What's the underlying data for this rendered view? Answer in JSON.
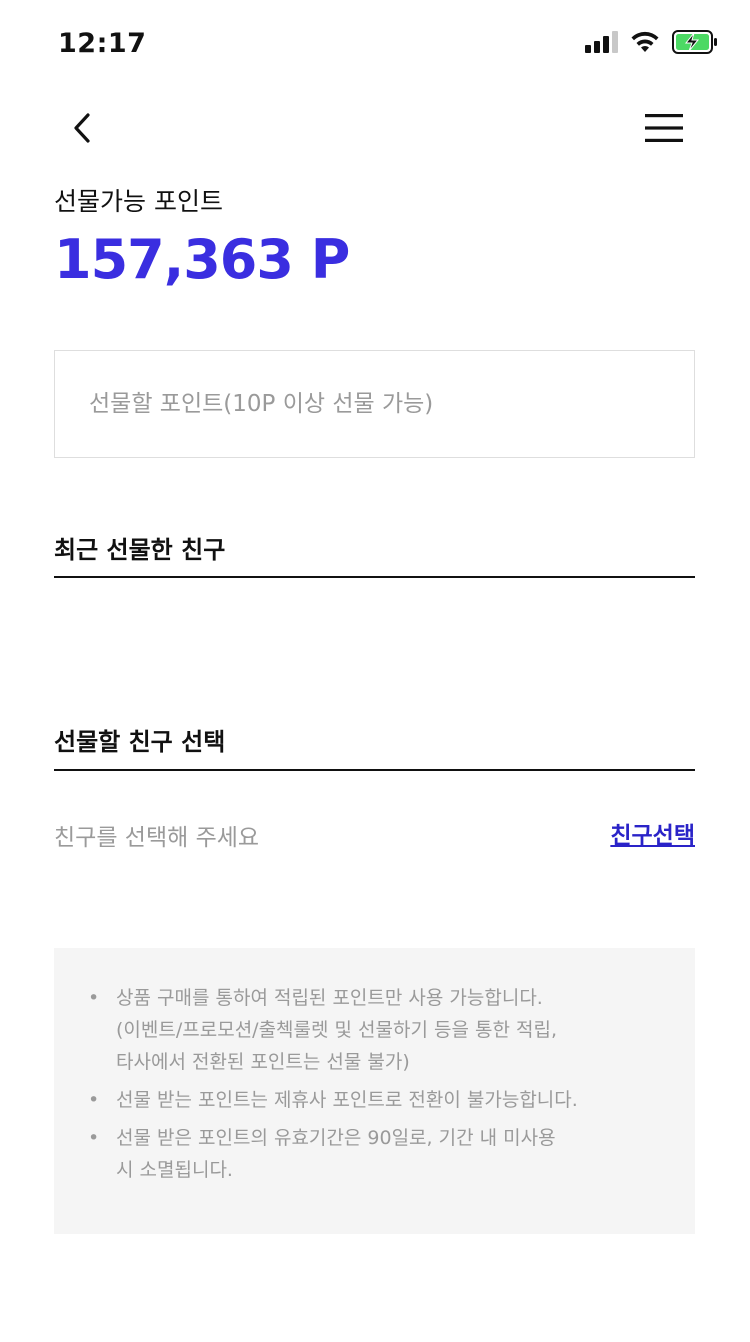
{
  "status_bar": {
    "time": "12:17"
  },
  "points": {
    "label": "선물가능 포인트",
    "value": "157,363 P",
    "accent_color": "#3a2ee0"
  },
  "gift_input": {
    "placeholder": "선물할 포인트(10P 이상 선물 가능)",
    "value": ""
  },
  "recent_friends": {
    "title": "최근 선물한 친구"
  },
  "select_friend": {
    "title": "선물할 친구 선택",
    "placeholder": "친구를 선택해 주세요",
    "link_label": "친구선택"
  },
  "notices": {
    "items": [
      {
        "lines": [
          "상품 구매를 통하여 적립된 포인트만 사용 가능합니다.",
          "(이벤트/프로모션/출첵룰렛 및 선물하기 등을 통한 적립,",
          "타사에서 전환된 포인트는 선물 불가)"
        ]
      },
      {
        "lines": [
          "선물 받는 포인트는 제휴사 포인트로 전환이 불가능합니다."
        ]
      },
      {
        "lines": [
          "선물 받은 포인트의 유효기간은 90일로, 기간 내 미사용",
          "시 소멸됩니다."
        ]
      }
    ]
  },
  "icons": {
    "back": "chevron-left-icon",
    "menu": "hamburger-menu-icon",
    "signal": "cellular-signal-icon",
    "wifi": "wifi-icon",
    "battery": "battery-charging-icon"
  }
}
